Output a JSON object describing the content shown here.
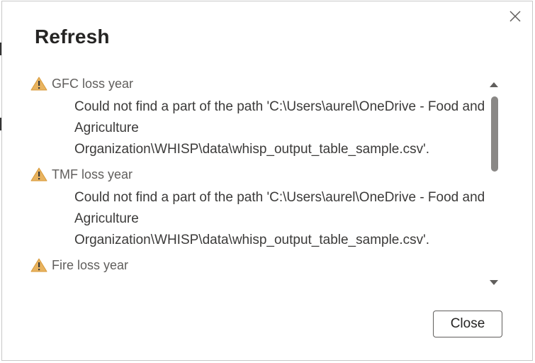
{
  "dialog": {
    "title": "Refresh",
    "close_button": "Close"
  },
  "errors": [
    {
      "name": "GFC loss year",
      "message": "Could not find a part of the path 'C:\\Users\\aurel\\OneDrive - Food and Agriculture Organization\\WHISP\\data\\whisp_output_table_sample.csv'."
    },
    {
      "name": "TMF loss year",
      "message": "Could not find a part of the path 'C:\\Users\\aurel\\OneDrive - Food and Agriculture Organization\\WHISP\\data\\whisp_output_table_sample.csv'."
    },
    {
      "name": "Fire loss year",
      "message": ""
    }
  ],
  "icons": {
    "warning": "warning-icon",
    "dismiss": "close-icon"
  },
  "colors": {
    "warning_fill": "#E8B35F",
    "scroll_thumb": "#8A8886"
  }
}
